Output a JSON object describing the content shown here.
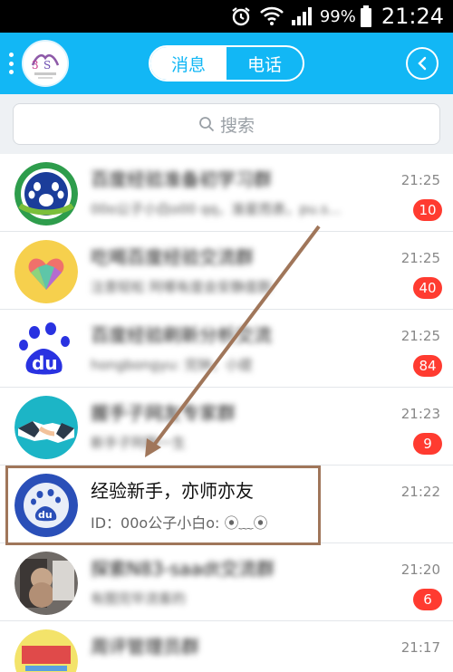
{
  "status_bar": {
    "battery_pct": "99%",
    "time": "21:24"
  },
  "header": {
    "tabs": [
      {
        "label": "消息",
        "active": true
      },
      {
        "label": "电话",
        "active": false
      }
    ]
  },
  "search": {
    "placeholder": "搜索"
  },
  "chats": [
    {
      "name": "百度经验准备初学习群",
      "preview": "00o公子小白o00 qq，准星而表，pu.s...",
      "time": "21:25",
      "unread": "10"
    },
    {
      "name": "吃喝百度经验交流群",
      "preview": "注意轻松 阿哪有度会安静度群",
      "time": "21:25",
      "unread": "40"
    },
    {
      "name": "百度经验刷新分析交流",
      "preview": "hongbongyu: 完钟，小提",
      "time": "21:25",
      "unread": "84"
    },
    {
      "name": "握手子网友专家群",
      "preview": "新手子阿群一生",
      "time": "21:23",
      "unread": "9"
    },
    {
      "name": "经验新手，亦师亦友",
      "preview": "ID：00o公子小白o: ⦿﹏⦿",
      "time": "21:22",
      "unread": ""
    },
    {
      "name": "探索N83-saadt交流群",
      "preview": "有图完毕流客的",
      "time": "21:20",
      "unread": "6"
    },
    {
      "name": "周评管理员群",
      "preview": "",
      "time": "21:17",
      "unread": ""
    }
  ],
  "colors": {
    "accent": "#12b7f5",
    "badge": "#ff3b30",
    "highlight": "#a0765a"
  }
}
